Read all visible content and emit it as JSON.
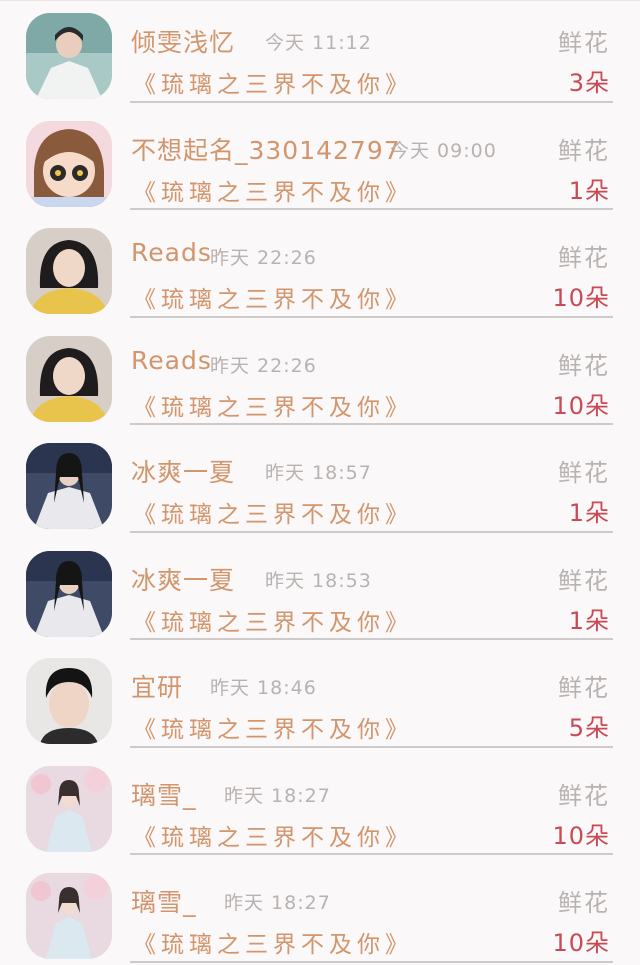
{
  "rows": [
    {
      "name": "倾雯浅忆",
      "time": "今天 11:12",
      "book": "《琉璃之三界不及你》",
      "gift_label": "鲜花",
      "gift_count": "3朵",
      "avatar": "avatar-photo-man-white-robe"
    },
    {
      "name": "不想起名_330142797",
      "time": "今天 09:00",
      "book": "《琉璃之三界不及你》",
      "gift_label": "鲜花",
      "gift_count": "1朵",
      "avatar": "avatar-cartoon-girl"
    },
    {
      "name": "Reads",
      "time": "昨天 22:26",
      "book": "《琉璃之三界不及你》",
      "gift_label": "鲜花",
      "gift_count": "10朵",
      "avatar": "avatar-photo-woman-yellow"
    },
    {
      "name": "Reads",
      "time": "昨天 22:26",
      "book": "《琉璃之三界不及你》",
      "gift_label": "鲜花",
      "gift_count": "10朵",
      "avatar": "avatar-photo-woman-yellow"
    },
    {
      "name": "冰爽一夏",
      "time": "昨天 18:57",
      "book": "《琉璃之三界不及你》",
      "gift_label": "鲜花",
      "gift_count": "1朵",
      "avatar": "avatar-photo-man-costume"
    },
    {
      "name": "冰爽一夏",
      "time": "昨天 18:53",
      "book": "《琉璃之三界不及你》",
      "gift_label": "鲜花",
      "gift_count": "1朵",
      "avatar": "avatar-photo-man-costume"
    },
    {
      "name": "宜研",
      "time": "昨天 18:46",
      "book": "《琉璃之三界不及你》",
      "gift_label": "鲜花",
      "gift_count": "5朵",
      "avatar": "avatar-photo-man-portrait"
    },
    {
      "name": "璃雪_",
      "time": "昨天 18:27",
      "book": "《琉璃之三界不及你》",
      "gift_label": "鲜花",
      "gift_count": "10朵",
      "avatar": "avatar-photo-woman-blossom"
    },
    {
      "name": "璃雪_",
      "time": "昨天 18:27",
      "book": "《琉璃之三界不及你》",
      "gift_label": "鲜花",
      "gift_count": "10朵",
      "avatar": "avatar-photo-woman-blossom"
    }
  ],
  "colors": {
    "name": "#d2956c",
    "time": "#b8b2b0",
    "count": "#c94a54",
    "divider": "#cfcaca",
    "background": "#faf8f8"
  }
}
